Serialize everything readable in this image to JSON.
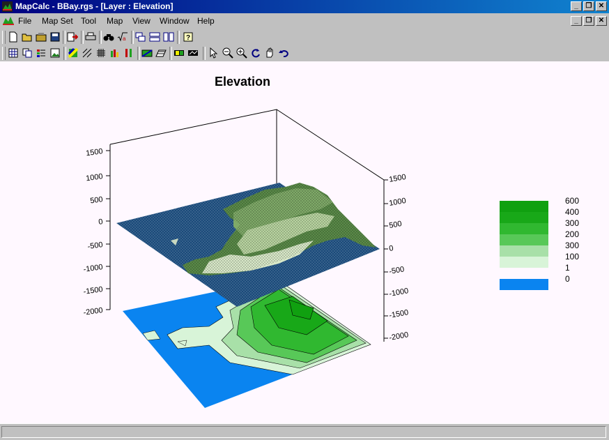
{
  "window": {
    "title": "MapCalc - BBay.rgs - [Layer : Elevation]",
    "controls": [
      "_",
      "❐",
      "✕"
    ]
  },
  "menu": [
    "File",
    "Map Set",
    "Tool",
    "Map",
    "View",
    "Window",
    "Help"
  ],
  "chart_data": {
    "type": "3d-surface",
    "title": "Elevation",
    "left_axis_ticks": [
      "1500",
      "1000",
      "500",
      "0",
      "-500",
      "-1000",
      "-1500",
      "-2000"
    ],
    "right_axis_ticks": [
      "1500",
      "1000",
      "500",
      "0",
      "-500",
      "-1000",
      "-1500",
      "-2000"
    ],
    "legend": [
      {
        "label": "600",
        "color": "#10a010"
      },
      {
        "label": "400",
        "color": "#18a818"
      },
      {
        "label": "300",
        "color": "#30b830"
      },
      {
        "label": "200",
        "color": "#58c858"
      },
      {
        "label": "300",
        "color": "#a8e0a8"
      },
      {
        "label": "100",
        "color": "#d8f4d8"
      },
      {
        "label": "1",
        "color": "#fff8ff"
      },
      {
        "label": "0",
        "color": "#0a84f0"
      }
    ]
  }
}
